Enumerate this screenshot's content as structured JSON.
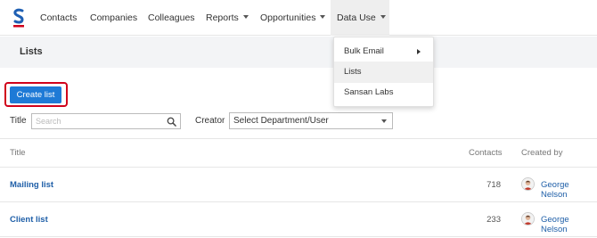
{
  "nav": {
    "items": [
      {
        "label": "Contacts"
      },
      {
        "label": "Companies"
      },
      {
        "label": "Colleagues"
      },
      {
        "label": "Reports"
      },
      {
        "label": "Opportunities"
      },
      {
        "label": "Data Use"
      }
    ],
    "logo_color_top": "#1e5fb3",
    "logo_color_bottom": "#d0021b"
  },
  "page": {
    "title": "Lists",
    "create_button": "Create list"
  },
  "filters": {
    "title_label": "Title",
    "search_placeholder": "Search",
    "creator_label": "Creator",
    "creator_value": "Select Department/User"
  },
  "table": {
    "headers": {
      "title": "Title",
      "contacts": "Contacts",
      "created_by": "Created by"
    },
    "rows": [
      {
        "title": "Mailing list",
        "contacts": "718",
        "created_by": "George Nelson"
      },
      {
        "title": "Client list",
        "contacts": "233",
        "created_by": "George Nelson"
      }
    ]
  },
  "dropdown": {
    "items": [
      {
        "label": "Bulk Email",
        "submenu": true
      },
      {
        "label": "Lists",
        "submenu": false
      },
      {
        "label": "Sansan Labs",
        "submenu": false
      }
    ]
  },
  "colors": {
    "accent": "#1e7ad6",
    "highlight": "#d0021b",
    "link": "#1f5fa8"
  }
}
